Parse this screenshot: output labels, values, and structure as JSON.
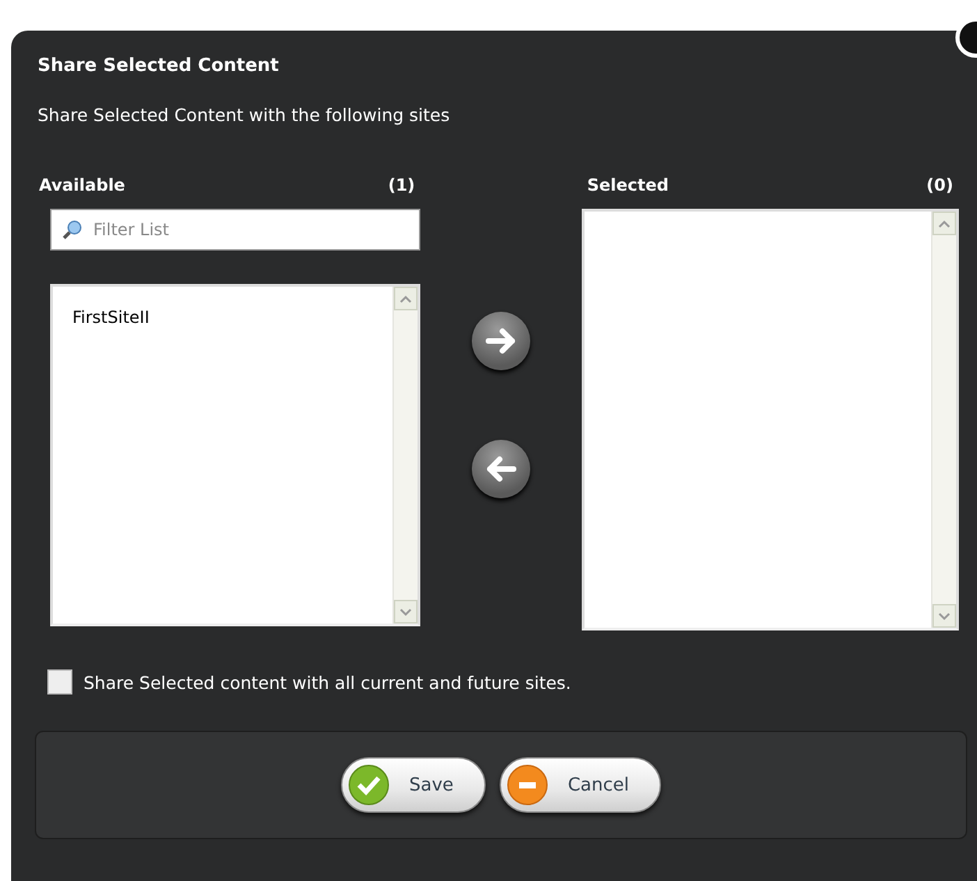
{
  "dialog": {
    "title": "Share Selected Content",
    "subtitle": "Share Selected Content with the following sites"
  },
  "available": {
    "label": "Available",
    "count": "(1)",
    "filter": {
      "placeholder": "Filter List"
    },
    "items": [
      {
        "label": "FirstSiteII",
        "selected": false
      }
    ]
  },
  "selected": {
    "label": "Selected",
    "count": "(0)"
  },
  "share_all": {
    "label": "Share Selected content with all current and future sites.",
    "checked": false
  },
  "buttons": [
    {
      "label": "Save",
      "kind": "save"
    },
    {
      "label": "Cancel",
      "kind": "cancel"
    }
  ]
}
